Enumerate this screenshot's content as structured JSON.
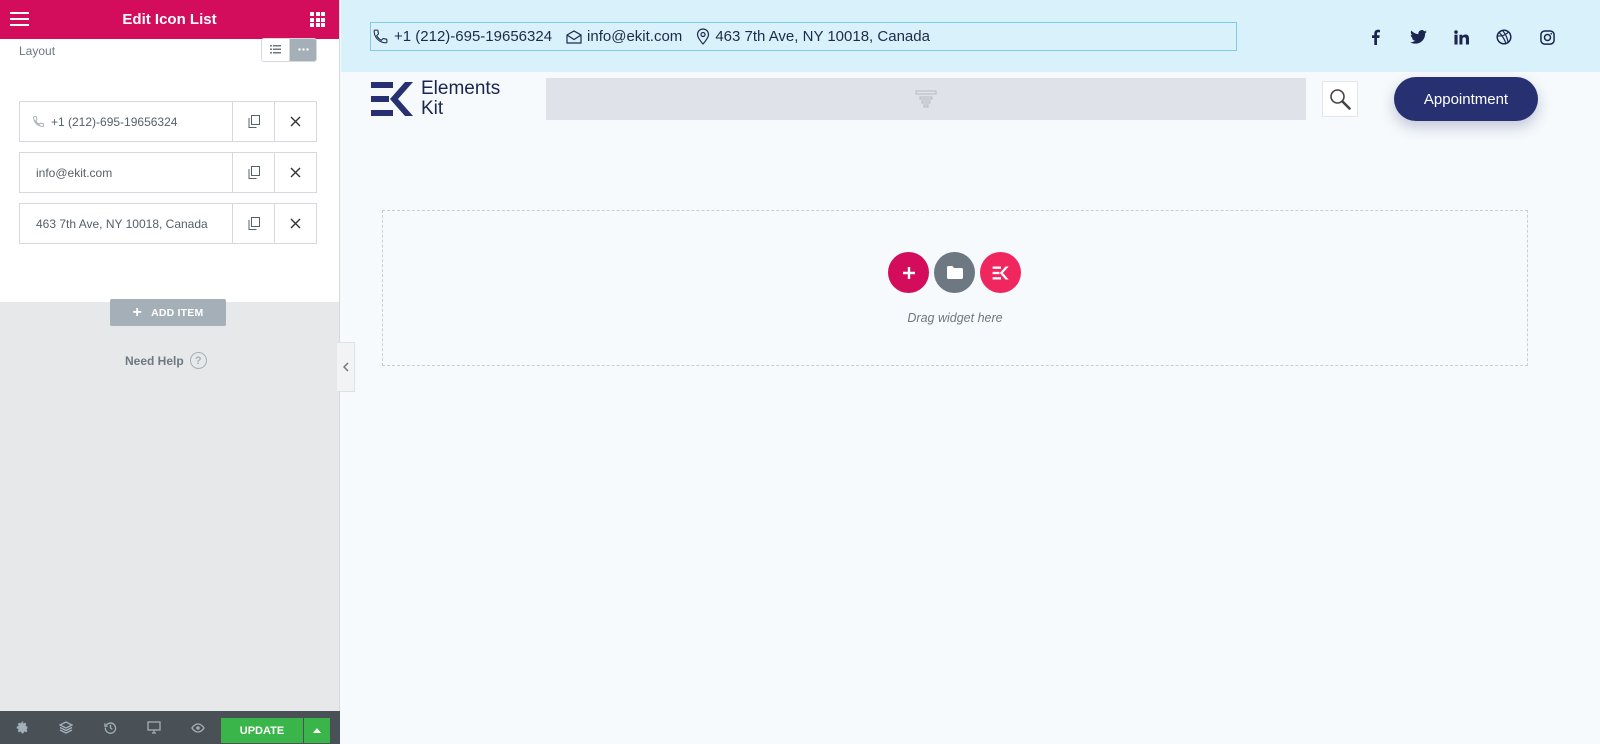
{
  "panel": {
    "title": "Edit Icon List",
    "layout_label": "Layout",
    "layout_options": [
      "default",
      "inline"
    ],
    "items": [
      {
        "text": "+1 (212)-695-19656324",
        "icon": "phone-icon"
      },
      {
        "text": "info@ekit.com",
        "icon": ""
      },
      {
        "text": "463 7th Ave, NY 10018, Canada",
        "icon": ""
      }
    ],
    "add_item": "ADD ITEM",
    "need_help": "Need Help",
    "help_icon": "?",
    "footer": {
      "update": "UPDATE",
      "icons": [
        "settings-icon",
        "navigator-icon",
        "history-icon",
        "responsive-icon",
        "preview-icon"
      ]
    }
  },
  "topbar": {
    "contacts": [
      {
        "text": "+1 (212)-695-19656324",
        "icon": "phone-icon"
      },
      {
        "text": "info@ekit.com",
        "icon": "envelope-icon"
      },
      {
        "text": "463 7th Ave, NY 10018, Canada",
        "icon": "map-pin-icon"
      }
    ],
    "socials": [
      "facebook-icon",
      "twitter-icon",
      "linkedin-icon",
      "dribbble-icon",
      "instagram-icon"
    ]
  },
  "header": {
    "logo_line1": "Elements",
    "logo_line2": "Kit",
    "appointment": "Appointment"
  },
  "dropzone": {
    "hint": "Drag widget here"
  },
  "colors": {
    "brand": "#d30c5c",
    "topbar_bg": "#d9f1fb",
    "navy": "#273171",
    "update_green": "#39b54a"
  }
}
